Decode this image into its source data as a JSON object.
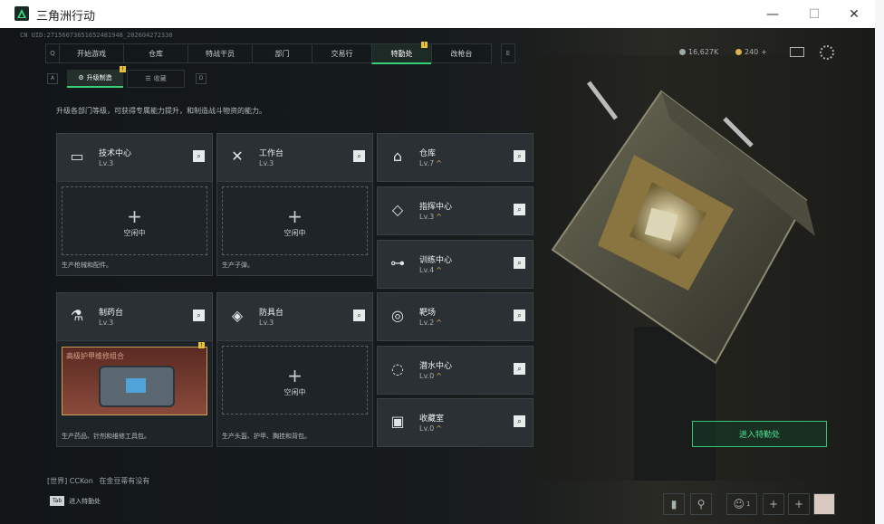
{
  "window": {
    "title": "三角洲行动",
    "min": "—",
    "max": "☐",
    "close": "✕"
  },
  "uid": "CN UID:27156073651652481948_202604272330",
  "nav": {
    "left_key": "Q",
    "right_key": "E",
    "tabs": [
      "开始游戏",
      "仓库",
      "特战干员",
      "部门",
      "交易行",
      "特勤处",
      "改枪台"
    ],
    "active_tab": "特勤处",
    "tab_badge": "!"
  },
  "resources": {
    "currency_a": "16,627K",
    "currency_b": "240",
    "plus": "+"
  },
  "subnav": {
    "left_key": "A",
    "right_key": "D",
    "tabs": [
      "升级制造",
      "收藏"
    ],
    "badge": "!"
  },
  "description": "升级各部门等级，可获得专属能力提升，和制造战斗物资的能力。",
  "workshops": [
    {
      "name": "技术中心",
      "level": "Lv.3",
      "footer": "生产枪械和配件。",
      "slot_status": "空闲中",
      "slot_plus": "+"
    },
    {
      "name": "工作台",
      "level": "Lv.3",
      "footer": "生产子弹。",
      "slot_status": "空闲中",
      "slot_plus": "+"
    },
    {
      "name": "制药台",
      "level": "Lv.3",
      "footer": "生产药品、针剂和维修工具包。",
      "slot_status": "高级护甲维修组合",
      "slot_badge": "!"
    },
    {
      "name": "防具台",
      "level": "Lv.3",
      "footer": "生产头盔、护甲、胸挂和背包。",
      "slot_status": "空闲中",
      "slot_plus": "+"
    }
  ],
  "departments": [
    {
      "name": "仓库",
      "level": "Lv.7",
      "up": "^"
    },
    {
      "name": "指挥中心",
      "level": "Lv.3",
      "up": "^"
    },
    {
      "name": "训练中心",
      "level": "Lv.4",
      "up": "^"
    },
    {
      "name": "靶场",
      "level": "Lv.2",
      "up": "^"
    },
    {
      "name": "潜水中心",
      "level": "Lv.0",
      "up": "^"
    },
    {
      "name": "收藏室",
      "level": "Lv.0",
      "up": "^"
    }
  ],
  "enter_button": "进入特勤处",
  "chat": {
    "channel": "[世界]",
    "user": "CCKon",
    "message": "在金豆蒂有没有"
  },
  "tab_hint": {
    "key": "Tab",
    "label": "进入特勤处"
  },
  "bottom_icons": [
    "chart-icon",
    "pin-icon",
    "friends-icon",
    "add-icon",
    "add-icon",
    "avatar"
  ],
  "friends_count": "1"
}
